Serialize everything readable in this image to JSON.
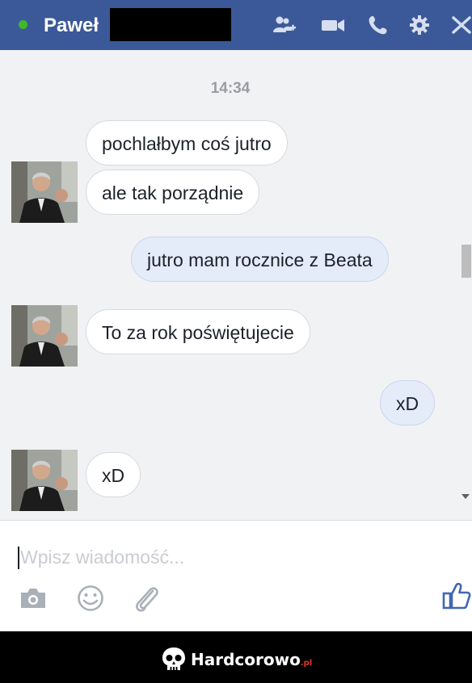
{
  "header": {
    "contact_name": "Paweł",
    "online": true,
    "icons": [
      "add-people-icon",
      "video-call-icon",
      "phone-icon",
      "gear-icon",
      "close-icon"
    ],
    "colors": {
      "bar": "#3b5998",
      "online_dot": "#42b72a"
    }
  },
  "conversation": {
    "timestamp": "14:34",
    "messages": [
      {
        "from": "contact",
        "text": "pochlałbym coś jutro"
      },
      {
        "from": "contact",
        "text": "ale tak porządnie"
      },
      {
        "from": "me",
        "text": "jutro mam rocznice z Beata"
      },
      {
        "from": "contact",
        "text": "To za rok poświętujecie"
      },
      {
        "from": "me",
        "text": "xD"
      },
      {
        "from": "contact",
        "text": "xD"
      }
    ],
    "colors": {
      "incoming_bubble": "#ffffff",
      "outgoing_bubble": "#e4ecfa",
      "background": "#f1f2f4"
    }
  },
  "composer": {
    "placeholder": "Wpisz wiadomość...",
    "value": "",
    "icons": [
      "camera-icon",
      "emoji-icon",
      "attachment-icon",
      "like-icon"
    ]
  },
  "watermark": {
    "brand": "Hardcorowo",
    "tld": ".pl"
  }
}
